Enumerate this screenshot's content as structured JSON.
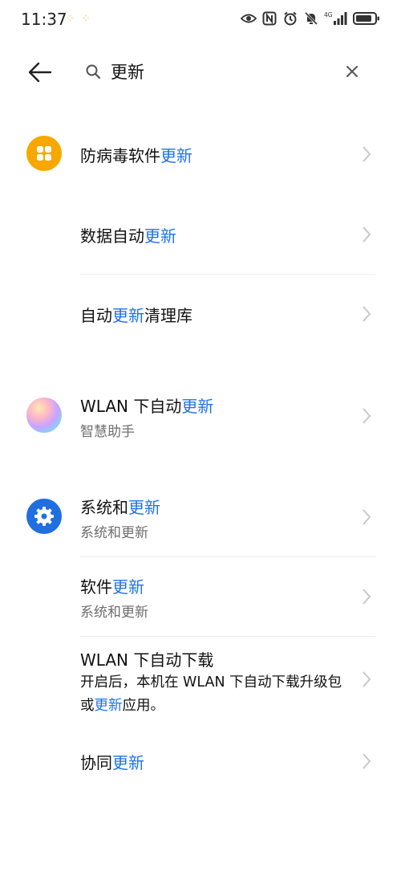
{
  "status": {
    "time": "11:37",
    "notif_dots": "⁘⁘",
    "network_label": "4G"
  },
  "search": {
    "query": "更新"
  },
  "results": [
    {
      "title_pre": "防病毒软件",
      "title_hl": "更新",
      "title_post": "",
      "subtitle": ""
    },
    {
      "title_pre": "数据自动",
      "title_hl": "更新",
      "title_post": "",
      "subtitle": ""
    },
    {
      "title_pre": "自动",
      "title_hl": "更新",
      "title_post": "清理库",
      "subtitle": ""
    },
    {
      "title_pre": "WLAN 下自动",
      "title_hl": "更新",
      "title_post": "",
      "subtitle": "智慧助手"
    },
    {
      "title_pre": "系统和",
      "title_hl": "更新",
      "title_post": "",
      "subtitle": "系统和更新"
    },
    {
      "title_pre": "软件",
      "title_hl": "更新",
      "title_post": "",
      "subtitle": "系统和更新"
    },
    {
      "title_pre": "WLAN 下自动下载",
      "title_hl": "",
      "title_post": "",
      "desc_pre": "开启后，本机在 WLAN 下自动下载升级包或",
      "desc_hl": "更新",
      "desc_post": "应用。"
    },
    {
      "title_pre": "协同",
      "title_hl": "更新",
      "title_post": "",
      "subtitle": ""
    }
  ],
  "colors": {
    "highlight": "#1f72e8",
    "antivirus_icon": "#f6a800",
    "settings_icon": "#1f6fe0"
  },
  "icons": {
    "back": "arrow-left-icon",
    "search": "search-icon",
    "clear": "close-icon",
    "chevron": "chevron-right-icon"
  }
}
